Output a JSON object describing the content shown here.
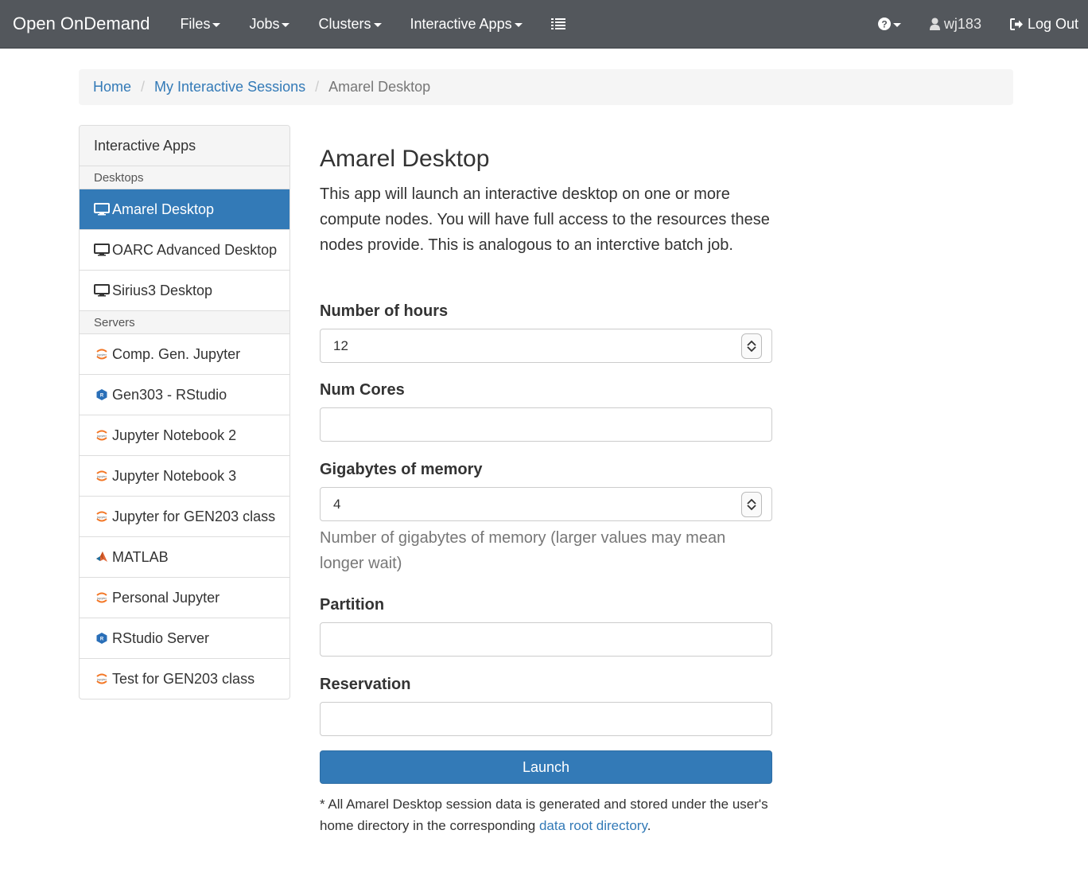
{
  "navbar": {
    "brand": "Open OnDemand",
    "menus": [
      {
        "label": "Files"
      },
      {
        "label": "Jobs"
      },
      {
        "label": "Clusters"
      },
      {
        "label": "Interactive Apps"
      }
    ],
    "user": "wj183",
    "logout": "Log Out"
  },
  "breadcrumb": {
    "home": "Home",
    "sessions": "My Interactive Sessions",
    "current": "Amarel Desktop"
  },
  "sidebar": {
    "heading": "Interactive Apps",
    "desktops_label": "Desktops",
    "desktops": [
      {
        "label": "Amarel Desktop",
        "icon": "desktop-icon",
        "active": true
      },
      {
        "label": "OARC Advanced Desktop",
        "icon": "desktop-icon"
      },
      {
        "label": "Sirius3 Desktop",
        "icon": "desktop-icon"
      }
    ],
    "servers_label": "Servers",
    "servers": [
      {
        "label": "Comp. Gen. Jupyter",
        "icon": "jupyter-icon"
      },
      {
        "label": "Gen303 - RStudio",
        "icon": "rstudio-icon"
      },
      {
        "label": "Jupyter Notebook 2",
        "icon": "jupyter-icon"
      },
      {
        "label": "Jupyter Notebook 3",
        "icon": "jupyter-icon"
      },
      {
        "label": "Jupyter for GEN203 class",
        "icon": "jupyter-icon"
      },
      {
        "label": "MATLAB",
        "icon": "matlab-icon"
      },
      {
        "label": "Personal Jupyter",
        "icon": "jupyter-icon"
      },
      {
        "label": "RStudio Server",
        "icon": "rstudio-icon"
      },
      {
        "label": "Test for GEN203 class",
        "icon": "jupyter-icon"
      }
    ]
  },
  "form": {
    "title": "Amarel Desktop",
    "description": "This app will launch an interactive desktop on one or more compute nodes. You will have full access to the resources these nodes provide. This is analogous to an interctive batch job.",
    "hours_label": "Number of hours",
    "hours_value": "12",
    "cores_label": "Num Cores",
    "cores_value": "",
    "memory_label": "Gigabytes of memory",
    "memory_value": "4",
    "memory_help": "Number of gigabytes of memory (larger values may mean longer wait)",
    "partition_label": "Partition",
    "partition_value": "",
    "reservation_label": "Reservation",
    "reservation_value": "",
    "launch_label": "Launch",
    "footnote_prefix": "* All Amarel Desktop session data is generated and stored under the user's home directory in the corresponding ",
    "footnote_link": "data root directory",
    "footnote_suffix": "."
  },
  "colors": {
    "navbar": "#53575c",
    "primary": "#337ab7",
    "link": "#337ab7"
  }
}
